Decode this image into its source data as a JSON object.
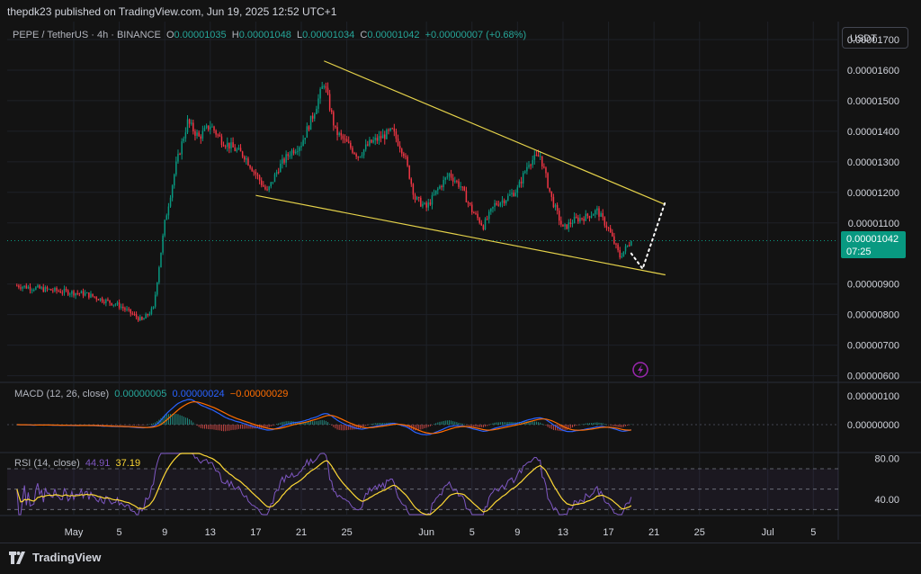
{
  "header": {
    "published": "thepdk23 published on TradingView.com, Jun 19, 2025 12:52 UTC+1",
    "symbol": "PEPE / TetherUS · 4h · BINANCE",
    "o_label": "O",
    "o": "0.00001035",
    "h_label": "H",
    "h": "0.00001048",
    "l_label": "L",
    "l": "0.00001034",
    "c_label": "C",
    "c": "0.00001042",
    "change": "+0.00000007 (+0.68%)",
    "currency_button": "USDT"
  },
  "price_tag": {
    "price": "0.00001042",
    "countdown": "07:25"
  },
  "macd_label": {
    "title": "MACD (12, 26, close)",
    "v1": "0.00000005",
    "v2": "0.00000024",
    "v3": "−0.00000029"
  },
  "rsi_label": {
    "title": "RSI (14, close)",
    "v1": "44.91",
    "v2": "37.19"
  },
  "footer": {
    "brand": "TradingView"
  },
  "colors": {
    "up": "#089981",
    "down": "#f23645",
    "trendline": "#e5d24a",
    "macd": "#2962ff",
    "signal": "#ff6d00",
    "rsi": "#7e57c2",
    "rsi_ma": "#fdd835"
  },
  "chart_data": [
    {
      "type": "candlestick",
      "title": "PEPE / TetherUS · 4h · BINANCE",
      "y_axis_ticks": [
        "0.00001700",
        "0.00001600",
        "0.00001500",
        "0.00001400",
        "0.00001300",
        "0.00001200",
        "0.00001100",
        "0.00000900",
        "0.00000800",
        "0.00000700",
        "0.00000600"
      ],
      "ylim": [
        5.9e-06,
        1.75e-05
      ],
      "x_ticks": [
        "May",
        "5",
        "9",
        "13",
        "17",
        "21",
        "25",
        "Jun",
        "5",
        "9",
        "13",
        "17",
        "21",
        "25",
        "Jul",
        "5"
      ],
      "last_close": 1.042e-05,
      "close_path": [
        [
          "Apr 26",
          8.95e-06
        ],
        [
          "Apr 29",
          8.8e-06
        ],
        [
          "May 2",
          8.68e-06
        ],
        [
          "May 5",
          8.3e-06
        ],
        [
          "May 7",
          7.8e-06
        ],
        [
          "May 8",
          8.2e-06
        ],
        [
          "May 9",
          1.1e-05
        ],
        [
          "May 10",
          1.29e-05
        ],
        [
          "May 11",
          1.43e-05
        ],
        [
          "May 12",
          1.38e-05
        ],
        [
          "May 13",
          1.42e-05
        ],
        [
          "May 14",
          1.37e-05
        ],
        [
          "May 16",
          1.32e-05
        ],
        [
          "May 18",
          1.2e-05
        ],
        [
          "May 19",
          1.28e-05
        ],
        [
          "May 20",
          1.33e-05
        ],
        [
          "May 21",
          1.36e-05
        ],
        [
          "May 22",
          1.45e-05
        ],
        [
          "May 23",
          1.56e-05
        ],
        [
          "May 24",
          1.4e-05
        ],
        [
          "May 26",
          1.32e-05
        ],
        [
          "May 27",
          1.36e-05
        ],
        [
          "May 29",
          1.4e-05
        ],
        [
          "May 30",
          1.33e-05
        ],
        [
          "May 31",
          1.18e-05
        ],
        [
          "Jun 1",
          1.15e-05
        ],
        [
          "Jun 2",
          1.21e-05
        ],
        [
          "Jun 3",
          1.26e-05
        ],
        [
          "Jun 4",
          1.22e-05
        ],
        [
          "Jun 5",
          1.14e-05
        ],
        [
          "Jun 6",
          1.09e-05
        ],
        [
          "Jun 7",
          1.16e-05
        ],
        [
          "Jun 8",
          1.18e-05
        ],
        [
          "Jun 9",
          1.21e-05
        ],
        [
          "Jun 10",
          1.3e-05
        ],
        [
          "Jun 11",
          1.32e-05
        ],
        [
          "Jun 12",
          1.18e-05
        ],
        [
          "Jun 13",
          1.08e-05
        ],
        [
          "Jun 14",
          1.11e-05
        ],
        [
          "Jun 15",
          1.12e-05
        ],
        [
          "Jun 16",
          1.14e-05
        ],
        [
          "Jun 17",
          1.08e-05
        ],
        [
          "Jun 18",
          9.9e-06
        ],
        [
          "Jun 19",
          1.042e-05
        ]
      ],
      "annotations": {
        "upper_trendline": [
          [
            "May 23",
            1.63e-05
          ],
          [
            "Jun 22",
            1.16e-05
          ]
        ],
        "lower_trendline": [
          [
            "May 17",
            1.19e-05
          ],
          [
            "Jun 22",
            9.3e-06
          ]
        ],
        "projection_path": [
          [
            "Jun 19",
            1e-05
          ],
          [
            "Jun 20",
            9.5e-06
          ],
          [
            "Jun 21",
            1.06e-05
          ],
          [
            "Jun 22",
            1.17e-05
          ]
        ]
      },
      "grid": true
    },
    {
      "type": "line",
      "title": "MACD (12, 26, close)",
      "y_axis_ticks": [
        "0.00000100",
        "0.00000000"
      ],
      "series": [
        {
          "name": "MACD"
        },
        {
          "name": "Signal"
        }
      ]
    },
    {
      "type": "line",
      "title": "RSI (14, close)",
      "y_axis_ticks": [
        "80.00",
        "40.00"
      ],
      "levels": [
        70,
        50,
        30
      ],
      "ylim": [
        25,
        85
      ],
      "series": [
        {
          "name": "RSI"
        },
        {
          "name": "RSI-based MA"
        }
      ]
    }
  ]
}
